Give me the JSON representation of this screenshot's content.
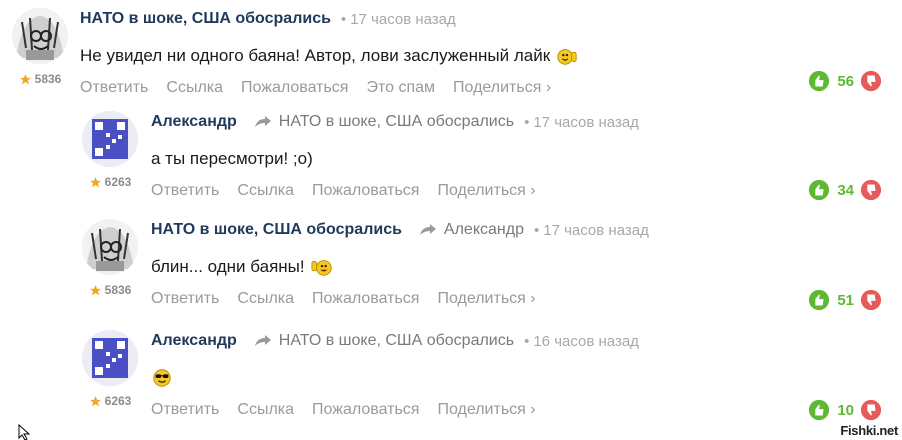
{
  "comments": [
    {
      "author": "НАТО в шоке, США обосрались",
      "reply_to": "",
      "time": "17 часов назад",
      "text": "Не увидел ни одного баяна! Автор, лови заслуженный лайк",
      "smiley": "thumbs-up-smiley-icon",
      "rating": "5836",
      "votes": "56",
      "actions": [
        "Ответить",
        "Ссылка",
        "Пожаловаться",
        "Это спам",
        "Поделиться ›"
      ]
    },
    {
      "author": "Александр",
      "reply_to": "НАТО в шоке, США обосрались",
      "time": "17 часов назад",
      "text": "а ты пересмотри! ;о)",
      "smiley": "",
      "rating": "6263",
      "votes": "34",
      "actions": [
        "Ответить",
        "Ссылка",
        "Пожаловаться",
        "Поделиться ›"
      ]
    },
    {
      "author": "НАТО в шоке, США обосрались",
      "reply_to": "Александр",
      "time": "17 часов назад",
      "text": "блин... одни баяны!",
      "smiley": "thumbs-up-smiley-icon",
      "rating": "5836",
      "votes": "51",
      "actions": [
        "Ответить",
        "Ссылка",
        "Пожаловаться",
        "Поделиться ›"
      ]
    },
    {
      "author": "Александр",
      "reply_to": "НАТО в шоке, США обосрались",
      "time": "16 часов назад",
      "text": "",
      "smiley": "sunglasses-smiley-icon",
      "rating": "6263",
      "votes": "10",
      "actions": [
        "Ответить",
        "Ссылка",
        "Пожаловаться",
        "Поделиться ›"
      ]
    }
  ],
  "colors": {
    "author": "#1f3a5c",
    "vote_up": "#5fb832",
    "vote_down": "#e85a5a",
    "muted": "#9a9a9a"
  },
  "watermark": "Fishki.net"
}
